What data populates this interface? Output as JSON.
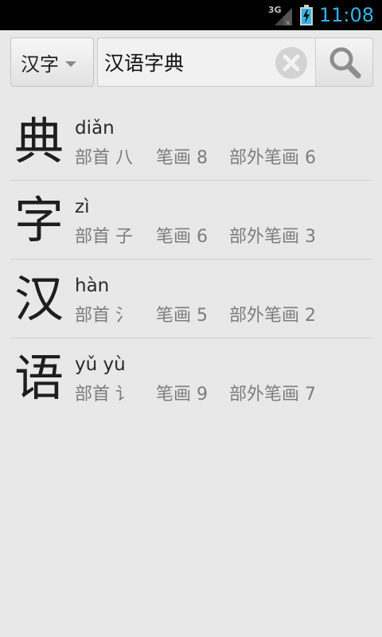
{
  "status_bar": {
    "network": "3G",
    "time": "11:08"
  },
  "search": {
    "language": "汉字",
    "query": "汉语字典"
  },
  "results": [
    {
      "char": "典",
      "pinyin": "diǎn",
      "radical": "部首 八",
      "strokes": "笔画 8",
      "extra_strokes": "部外笔画 6"
    },
    {
      "char": "字",
      "pinyin": "zì",
      "radical": "部首 子",
      "strokes": "笔画 6",
      "extra_strokes": "部外笔画 3"
    },
    {
      "char": "汉",
      "pinyin": "hàn",
      "radical": "部首 氵",
      "strokes": "笔画 5",
      "extra_strokes": "部外笔画 2"
    },
    {
      "char": "语",
      "pinyin": "yǔ   yù",
      "radical": "部首 讠",
      "strokes": "笔画 9",
      "extra_strokes": "部外笔画 7"
    }
  ],
  "colors": {
    "clock": "#33b5e5",
    "background": "#e8e8e8"
  },
  "icons": {
    "clear": "clear-icon",
    "search": "search-icon",
    "signal": "signal-icon",
    "battery": "battery-charging-icon"
  }
}
